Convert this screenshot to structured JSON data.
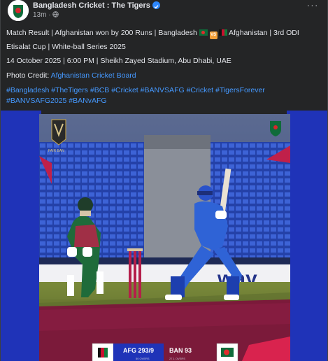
{
  "post": {
    "page_name": "Bangladesh Cricket : The Tigers",
    "time": "13m",
    "lines": [
      {
        "pre": "Match Result | Afghanistan won by 200 Runs | Bangladesh ",
        "post": " Afghanistan | 3rd ODI"
      },
      "Etisalat Cup | White-ball Series 2025",
      "14 October 2025 | 6:00 PM | Sheikh Zayed Stadium, Abu Dhabi, UAE"
    ],
    "photo_credit_label": "Photo Credit:",
    "photo_credit_link": "Afghanistan Cricket Board",
    "hashtags_line1": "#Bangladesh #TheTigers #BCB #Cricket #BANVSAFG #Cricket #TigersForever",
    "hashtags_line2": "#BANVSAFG2025 #BANvAFG",
    "vs_badge": "VS"
  },
  "image": {
    "score_afg": "AFG 293/9",
    "score_ban": "BAN 93",
    "score_afg_sub": "50 OVERS",
    "score_ban_sub": "27.1 OVERS",
    "series_logo": "FAIR BAN",
    "boundary_board": "way"
  },
  "colors": {
    "card_bg": "#242526",
    "link": "#4599ff",
    "verified": "#2d88ff",
    "media_side": "#1f33b8",
    "afg_jersey": "#2f63d6",
    "ban_jersey": "#1f6b3a"
  }
}
